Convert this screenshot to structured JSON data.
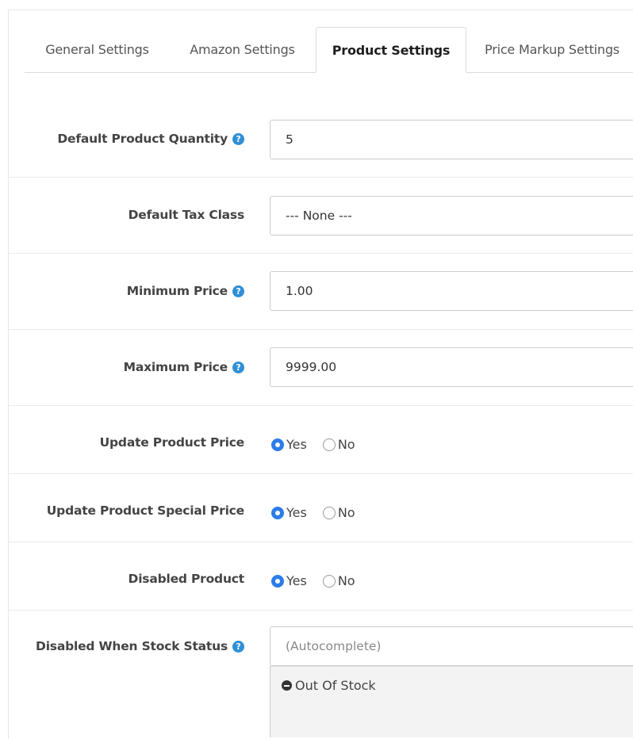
{
  "tabs": [
    {
      "label": "General Settings",
      "active": false
    },
    {
      "label": "Amazon Settings",
      "active": false
    },
    {
      "label": "Product Settings",
      "active": true
    },
    {
      "label": "Price Markup Settings",
      "active": false
    }
  ],
  "fields": {
    "default_quantity": {
      "label": "Default Product Quantity",
      "value": "5",
      "help_icon": "question-icon"
    },
    "tax_class": {
      "label": "Default Tax Class",
      "value": "--- None ---"
    },
    "minimum_price": {
      "label": "Minimum Price",
      "value": "1.00",
      "help_icon": "question-icon"
    },
    "maximum_price": {
      "label": "Maximum Price",
      "value": "9999.00",
      "help_icon": "question-icon"
    },
    "update_price": {
      "label": "Update Product Price",
      "yes": "Yes",
      "no": "No",
      "selected": "Yes"
    },
    "update_special_price": {
      "label": "Update Product Special Price",
      "yes": "Yes",
      "no": "No",
      "selected": "Yes"
    },
    "disabled_product": {
      "label": "Disabled Product",
      "yes": "Yes",
      "no": "No",
      "selected": "Yes"
    },
    "disabled_stock_status": {
      "label": "Disabled When Stock Status",
      "placeholder": "(Autocomplete)",
      "help_icon": "question-icon",
      "tags": [
        "Out Of Stock"
      ]
    }
  },
  "colors": {
    "accent": "#2b7de9",
    "help_icon": "#2f8fd8",
    "border": "#cccccc",
    "tag_box": "#f3f3f3"
  }
}
